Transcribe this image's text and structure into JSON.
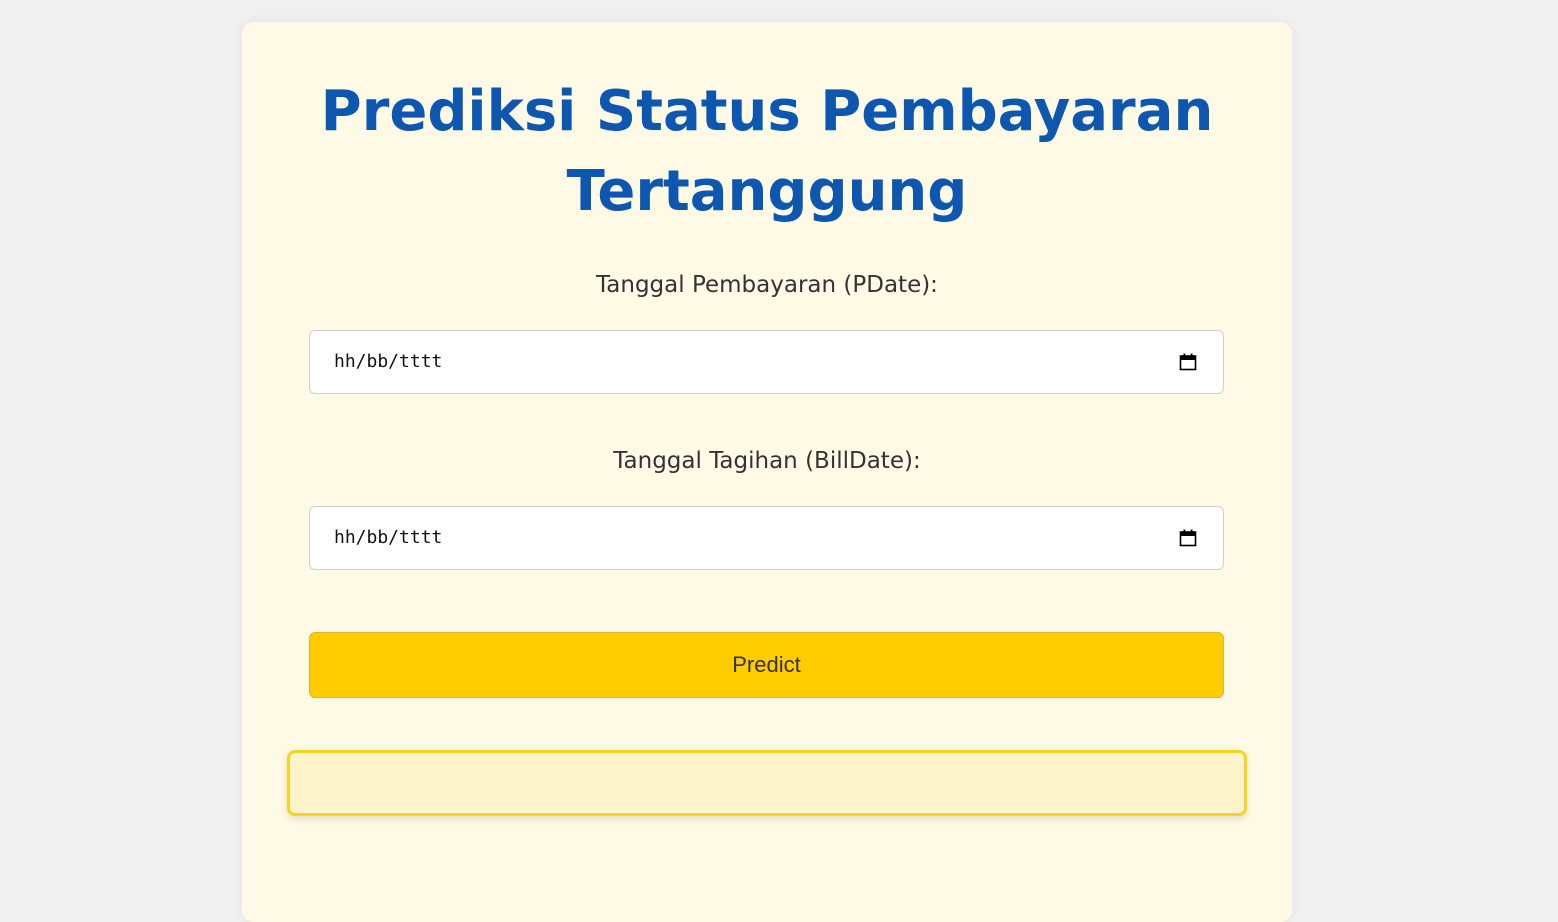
{
  "form": {
    "title_line1": "Prediksi Status Pembayaran",
    "title_line2": "Tertanggung",
    "pdate": {
      "label": "Tanggal Pembayaran (PDate):",
      "placeholder": "hh/bb/tttt"
    },
    "billdate": {
      "label": "Tanggal Tagihan (BillDate):",
      "placeholder": "hh/bb/tttt"
    },
    "submit_label": "Predict"
  },
  "result": {
    "text": ""
  },
  "colors": {
    "page_background": "#f0f0f0",
    "card_background": "#fffae6",
    "title": "#0d57b0",
    "button": "#ffcc00",
    "result_border": "#f5d31f",
    "result_background": "#fdf4cc"
  },
  "icons": {
    "date_picker": "calendar-icon"
  }
}
